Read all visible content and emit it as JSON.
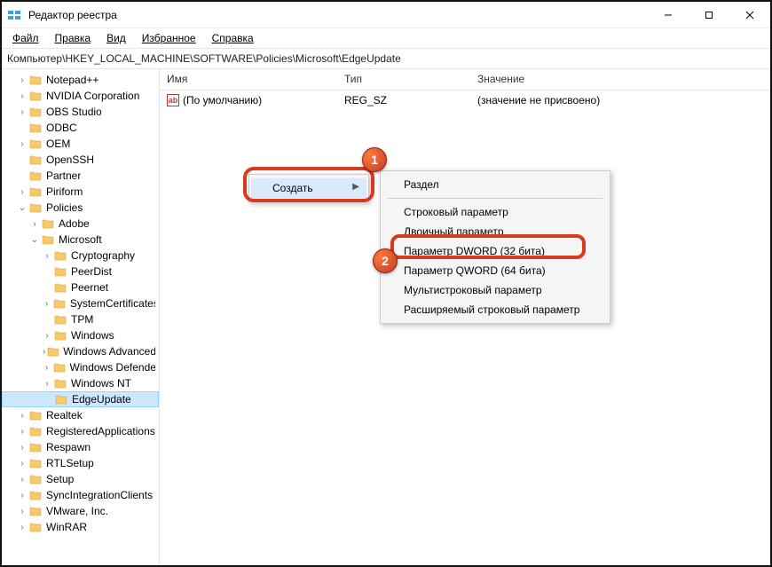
{
  "window": {
    "title": "Редактор реестра",
    "min": "—",
    "max": "▢",
    "close": "✕"
  },
  "menubar": {
    "file": "Файл",
    "edit": "Правка",
    "view": "Вид",
    "fav": "Избранное",
    "help": "Справка"
  },
  "address": "Компьютер\\HKEY_LOCAL_MACHINE\\SOFTWARE\\Policies\\Microsoft\\EdgeUpdate",
  "list": {
    "headers": {
      "name": "Имя",
      "type": "Тип",
      "value": "Значение"
    },
    "rows": [
      {
        "name": "(По умолчанию)",
        "type": "REG_SZ",
        "value": "(значение не присвоено)"
      }
    ]
  },
  "tree": {
    "items": [
      {
        "indent": 1,
        "toggle": ">",
        "label": "Notepad++"
      },
      {
        "indent": 1,
        "toggle": ">",
        "label": "NVIDIA Corporation"
      },
      {
        "indent": 1,
        "toggle": ">",
        "label": "OBS Studio"
      },
      {
        "indent": 1,
        "toggle": "",
        "label": "ODBC"
      },
      {
        "indent": 1,
        "toggle": ">",
        "label": "OEM"
      },
      {
        "indent": 1,
        "toggle": "",
        "label": "OpenSSH"
      },
      {
        "indent": 1,
        "toggle": "",
        "label": "Partner"
      },
      {
        "indent": 1,
        "toggle": ">",
        "label": "Piriform"
      },
      {
        "indent": 1,
        "toggle": "v",
        "label": "Policies"
      },
      {
        "indent": 2,
        "toggle": ">",
        "label": "Adobe"
      },
      {
        "indent": 2,
        "toggle": "v",
        "label": "Microsoft"
      },
      {
        "indent": 3,
        "toggle": ">",
        "label": "Cryptography"
      },
      {
        "indent": 3,
        "toggle": "",
        "label": "PeerDist"
      },
      {
        "indent": 3,
        "toggle": "",
        "label": "Peernet"
      },
      {
        "indent": 3,
        "toggle": ">",
        "label": "SystemCertificates"
      },
      {
        "indent": 3,
        "toggle": "",
        "label": "TPM"
      },
      {
        "indent": 3,
        "toggle": ">",
        "label": "Windows"
      },
      {
        "indent": 3,
        "toggle": ">",
        "label": "Windows Advanced Threat Protection"
      },
      {
        "indent": 3,
        "toggle": ">",
        "label": "Windows Defender"
      },
      {
        "indent": 3,
        "toggle": ">",
        "label": "Windows NT"
      },
      {
        "indent": 3,
        "toggle": "",
        "label": "EdgeUpdate",
        "selected": true
      },
      {
        "indent": 1,
        "toggle": ">",
        "label": "Realtek"
      },
      {
        "indent": 1,
        "toggle": ">",
        "label": "RegisteredApplications"
      },
      {
        "indent": 1,
        "toggle": ">",
        "label": "Respawn"
      },
      {
        "indent": 1,
        "toggle": ">",
        "label": "RTLSetup"
      },
      {
        "indent": 1,
        "toggle": ">",
        "label": "Setup"
      },
      {
        "indent": 1,
        "toggle": ">",
        "label": "SyncIntegrationClients"
      },
      {
        "indent": 1,
        "toggle": ">",
        "label": "VMware, Inc."
      },
      {
        "indent": 1,
        "toggle": ">",
        "label": "WinRAR"
      }
    ]
  },
  "ctx1": {
    "create": "Создать"
  },
  "ctx2": {
    "key": "Раздел",
    "string": "Строковый параметр",
    "binary": "Двоичный параметр",
    "dword": "Параметр DWORD (32 бита)",
    "qword": "Параметр QWORD (64 бита)",
    "multi": "Мультистроковый параметр",
    "expand": "Расширяемый строковый параметр"
  },
  "badges": {
    "one": "1",
    "two": "2"
  }
}
